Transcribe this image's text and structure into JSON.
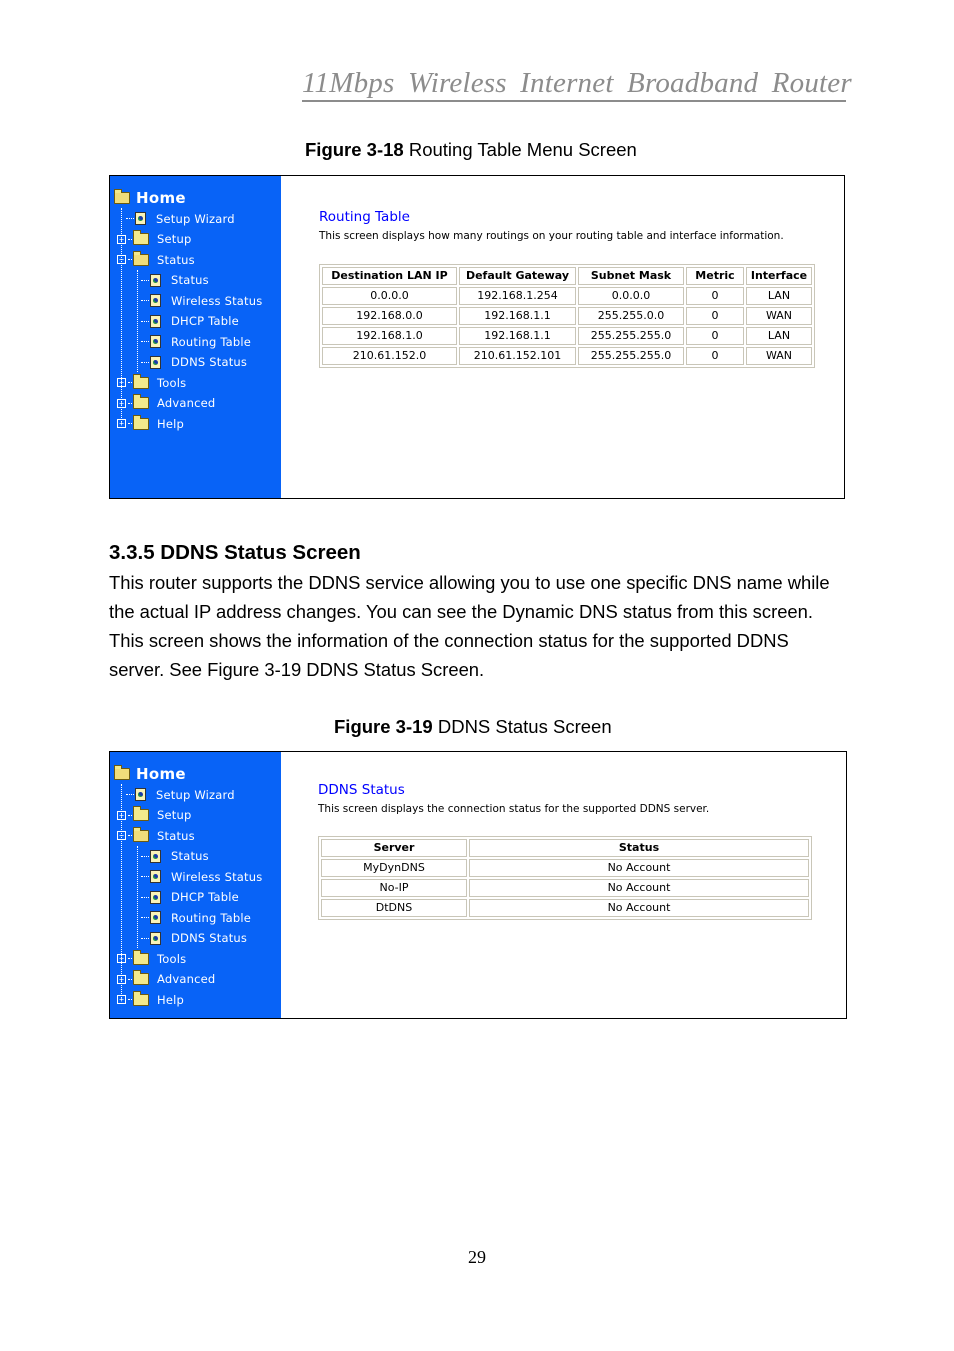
{
  "document": {
    "running_header": "11Mbps  Wireless  Internet  Broadband  Router",
    "page_number": "29"
  },
  "figure1": {
    "caption_label": "Figure 3-18",
    "caption_text": " Routing Table Menu Screen",
    "sidebar": {
      "home": "Home",
      "items": [
        {
          "label": "Setup Wizard",
          "icon": "page-icon",
          "level": 1
        },
        {
          "label": "Setup",
          "icon": "folder-icon",
          "level": 0,
          "expander": "+"
        },
        {
          "label": "Status",
          "icon": "folder-open-icon",
          "level": 0,
          "expander": "-"
        },
        {
          "label": "Status",
          "icon": "page-icon",
          "level": 2
        },
        {
          "label": "Wireless Status",
          "icon": "page-icon",
          "level": 2
        },
        {
          "label": "DHCP Table",
          "icon": "page-icon",
          "level": 2
        },
        {
          "label": "Routing Table",
          "icon": "page-icon",
          "level": 2
        },
        {
          "label": "DDNS Status",
          "icon": "page-icon",
          "level": 2
        },
        {
          "label": "Tools",
          "icon": "folder-icon",
          "level": 0,
          "expander": "+"
        },
        {
          "label": "Advanced",
          "icon": "folder-icon",
          "level": 0,
          "expander": "+"
        },
        {
          "label": "Help",
          "icon": "folder-icon",
          "level": 0,
          "expander": "+"
        }
      ]
    },
    "title": "Routing Table",
    "description": "This screen displays how many routings on your routing table and interface information.",
    "table": {
      "headers": [
        "Destination LAN IP",
        "Default Gateway",
        "Subnet Mask",
        "Metric",
        "Interface"
      ],
      "rows": [
        [
          "0.0.0.0",
          "192.168.1.254",
          "0.0.0.0",
          "0",
          "LAN"
        ],
        [
          "192.168.0.0",
          "192.168.1.1",
          "255.255.0.0",
          "0",
          "WAN"
        ],
        [
          "192.168.1.0",
          "192.168.1.1",
          "255.255.255.0",
          "0",
          "LAN"
        ],
        [
          "210.61.152.0",
          "210.61.152.101",
          "255.255.255.0",
          "0",
          "WAN"
        ]
      ]
    }
  },
  "section": {
    "heading": "3.3.5 DDNS Status Screen",
    "paragraph": "This router supports the DDNS service allowing you to use one specific DNS name while the actual IP address changes. You can see the Dynamic DNS status from this screen. This screen shows the information of the connection status for the supported DDNS server. See Figure 3-19 DDNS Status Screen."
  },
  "figure2": {
    "caption_label": "Figure 3-19",
    "caption_text": " DDNS Status Screen",
    "sidebar": {
      "home": "Home",
      "items": [
        {
          "label": "Setup Wizard",
          "icon": "page-icon",
          "level": 1
        },
        {
          "label": "Setup",
          "icon": "folder-icon",
          "level": 0,
          "expander": "+"
        },
        {
          "label": "Status",
          "icon": "folder-open-icon",
          "level": 0,
          "expander": "-"
        },
        {
          "label": "Status",
          "icon": "page-icon",
          "level": 2
        },
        {
          "label": "Wireless Status",
          "icon": "page-icon",
          "level": 2
        },
        {
          "label": "DHCP Table",
          "icon": "page-icon",
          "level": 2
        },
        {
          "label": "Routing Table",
          "icon": "page-icon",
          "level": 2
        },
        {
          "label": "DDNS Status",
          "icon": "page-icon",
          "level": 2
        },
        {
          "label": "Tools",
          "icon": "folder-icon",
          "level": 0,
          "expander": "+"
        },
        {
          "label": "Advanced",
          "icon": "folder-icon",
          "level": 0,
          "expander": "+"
        },
        {
          "label": "Help",
          "icon": "folder-icon",
          "level": 0,
          "expander": "+"
        }
      ]
    },
    "title": "DDNS Status",
    "description": "This screen displays the connection status for the supported DDNS server.",
    "table": {
      "headers": [
        "Server",
        "Status"
      ],
      "rows": [
        [
          "MyDynDNS",
          "No Account"
        ],
        [
          "No-IP",
          "No Account"
        ],
        [
          "DtDNS",
          "No Account"
        ]
      ]
    }
  },
  "colors": {
    "sidebar_bg": "#0863f7",
    "title_blue": "#0000ff",
    "header_gray": "#8c8c8c"
  }
}
